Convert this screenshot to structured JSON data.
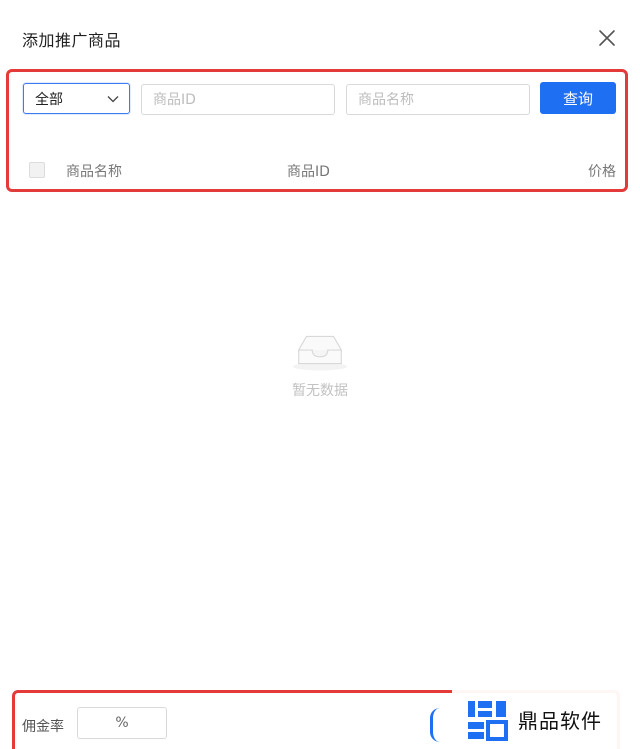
{
  "dialog": {
    "title": "添加推广商品"
  },
  "filters": {
    "category_selected": "全部",
    "product_id_placeholder": "商品ID",
    "product_name_placeholder": "商品名称",
    "query_label": "查询"
  },
  "table": {
    "columns": [
      "商品名称",
      "商品ID",
      "价格"
    ],
    "rows": []
  },
  "empty_state": {
    "text": "暂无数据",
    "icon": "empty-inbox-icon"
  },
  "footer": {
    "commission_label": "佣金率",
    "commission_suffix": "%"
  },
  "watermark": {
    "text": "鼎品软件"
  },
  "colors": {
    "primary": "#1e6ff1",
    "highlight": "#e43a3a"
  }
}
